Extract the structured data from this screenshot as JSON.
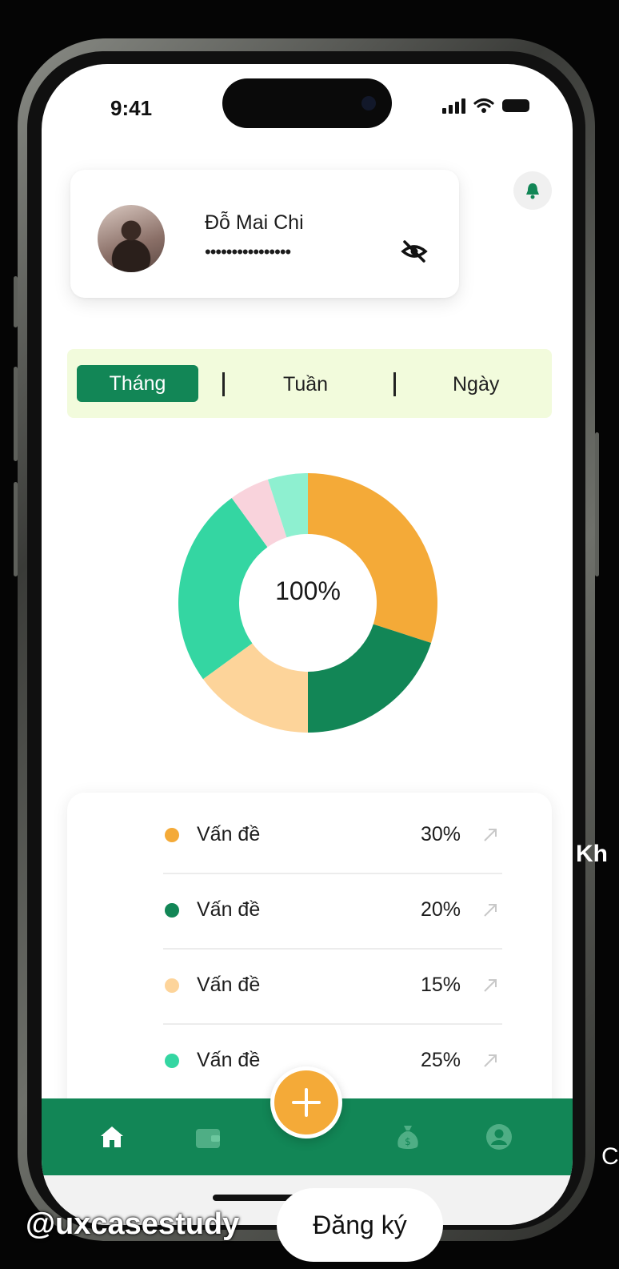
{
  "status_bar": {
    "time": "9:41"
  },
  "profile": {
    "name": "Đỗ Mai Chi",
    "masked_balance": "••••••••••••••••"
  },
  "tabs": [
    {
      "label": "Tháng",
      "active": true
    },
    {
      "label": "Tuần",
      "active": false
    },
    {
      "label": "Ngày",
      "active": false
    }
  ],
  "chart_data": {
    "type": "pie",
    "center_label": "100%",
    "slices": [
      {
        "value": 30,
        "color": "#f4aa38"
      },
      {
        "value": 20,
        "color": "#128656"
      },
      {
        "value": 15,
        "color": "#fdd49a"
      },
      {
        "value": 25,
        "color": "#34d6a2"
      },
      {
        "value": 5,
        "color": "#f9d3dc"
      },
      {
        "value": 5,
        "color": "#8ef0d0"
      }
    ]
  },
  "list": [
    {
      "label": "Vấn đề",
      "value": "30%",
      "color": "#f4aa38"
    },
    {
      "label": "Vấn đề",
      "value": "20%",
      "color": "#128656"
    },
    {
      "label": "Vấn đề",
      "value": "15%",
      "color": "#fdd49a"
    },
    {
      "label": "Vấn đề",
      "value": "25%",
      "color": "#34d6a2"
    }
  ],
  "nav": {
    "items": [
      "home-icon",
      "wallet-icon",
      "add-icon",
      "money-bag-icon",
      "profile-icon"
    ]
  },
  "overlay": {
    "watermark": "@uxcasestudy",
    "signup": "Đăng ký",
    "side_text": "Kh",
    "side_text2": "C"
  },
  "colors": {
    "primary": "#128656",
    "accent": "#f4aa38",
    "tab_bg": "#f2fbdc"
  }
}
